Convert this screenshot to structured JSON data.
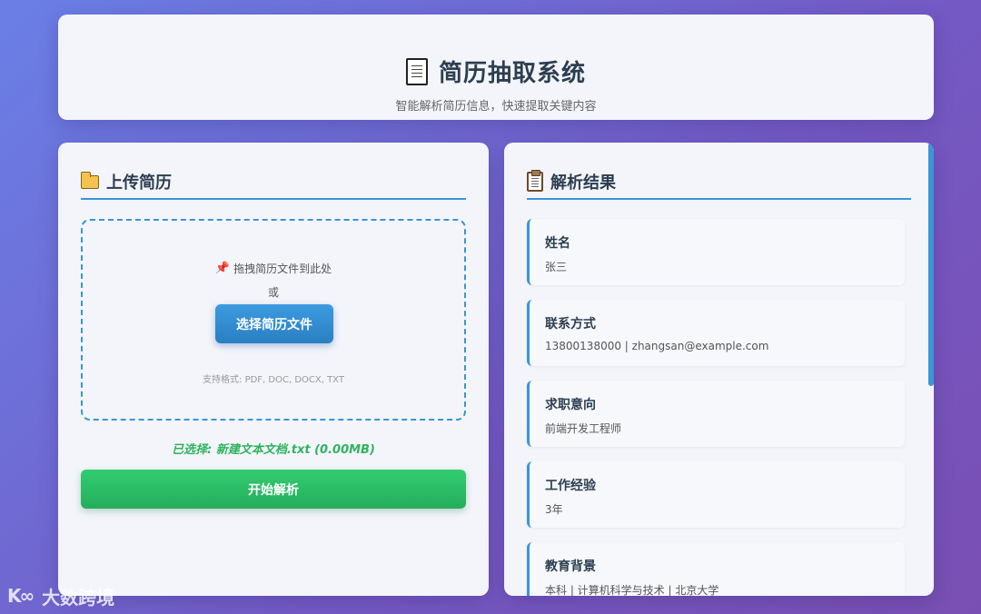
{
  "header": {
    "title": "简历抽取系统",
    "subtitle": "智能解析简历信息，快速提取关键内容"
  },
  "upload_panel": {
    "title": "上传简历",
    "drop_hint": "拖拽简历文件到此处",
    "or_text": "或",
    "choose_button": "选择简历文件",
    "formats": "支持格式: PDF, DOC, DOCX, TXT",
    "selected_file": "已选择: 新建文本文档.txt (0.00MB)",
    "start_button": "开始解析"
  },
  "result_panel": {
    "title": "解析结果",
    "items": [
      {
        "label": "姓名",
        "value": "张三"
      },
      {
        "label": "联系方式",
        "value": "13800138000 | zhangsan@example.com"
      },
      {
        "label": "求职意向",
        "value": "前端开发工程师"
      },
      {
        "label": "工作经验",
        "value": "3年"
      },
      {
        "label": "教育背景",
        "value": "本科 | 计算机科学与技术 | 北京大学"
      }
    ]
  },
  "watermark": {
    "logo": "K∞",
    "text": "大数跨境"
  },
  "colors": {
    "accent_blue": "#3b95d6",
    "success_green": "#2fb35f",
    "text_dark": "#2c3e50"
  }
}
